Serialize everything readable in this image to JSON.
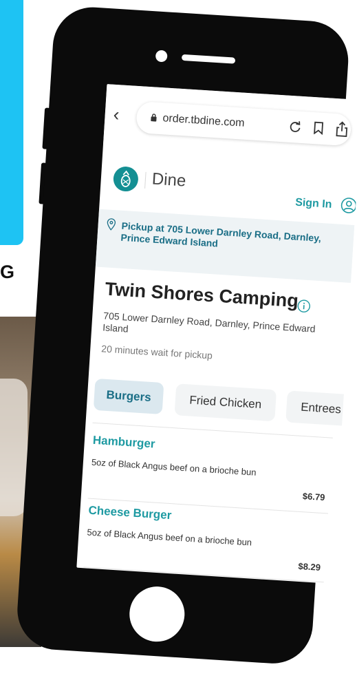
{
  "background": {
    "partial_text": "G"
  },
  "browser": {
    "back_icon": "chevron-left-icon",
    "url": "order.tbdine.com",
    "icons": [
      "lock-icon",
      "reload-icon",
      "bookmark-icon",
      "share-icon"
    ]
  },
  "header": {
    "brand": "Dine",
    "sign_in": "Sign In"
  },
  "pickup": {
    "text": "Pickup at 705 Lower Darnley Road, Darnley, Prince Edward Island"
  },
  "restaurant": {
    "name": "Twin Shores Camping",
    "address": "705 Lower Darnley Road, Darnley, Prince Edward Island",
    "wait": "20 minutes wait for pickup"
  },
  "tabs": [
    {
      "label": "Burgers",
      "active": true
    },
    {
      "label": "Fried Chicken",
      "active": false
    },
    {
      "label": "Entrees",
      "active": false
    }
  ],
  "menu": [
    {
      "name": "Hamburger",
      "description": "5oz of Black Angus beef on a brioche bun",
      "price": "$6.79"
    },
    {
      "name": "Cheese Burger",
      "description": "5oz of Black Angus beef on a brioche bun",
      "price": "$8.29"
    }
  ],
  "colors": {
    "accent": "#1e9aa2",
    "banner_bg": "#eef3f5",
    "banner_text": "#1a6e86",
    "background_blue": "#1ec3f3"
  }
}
